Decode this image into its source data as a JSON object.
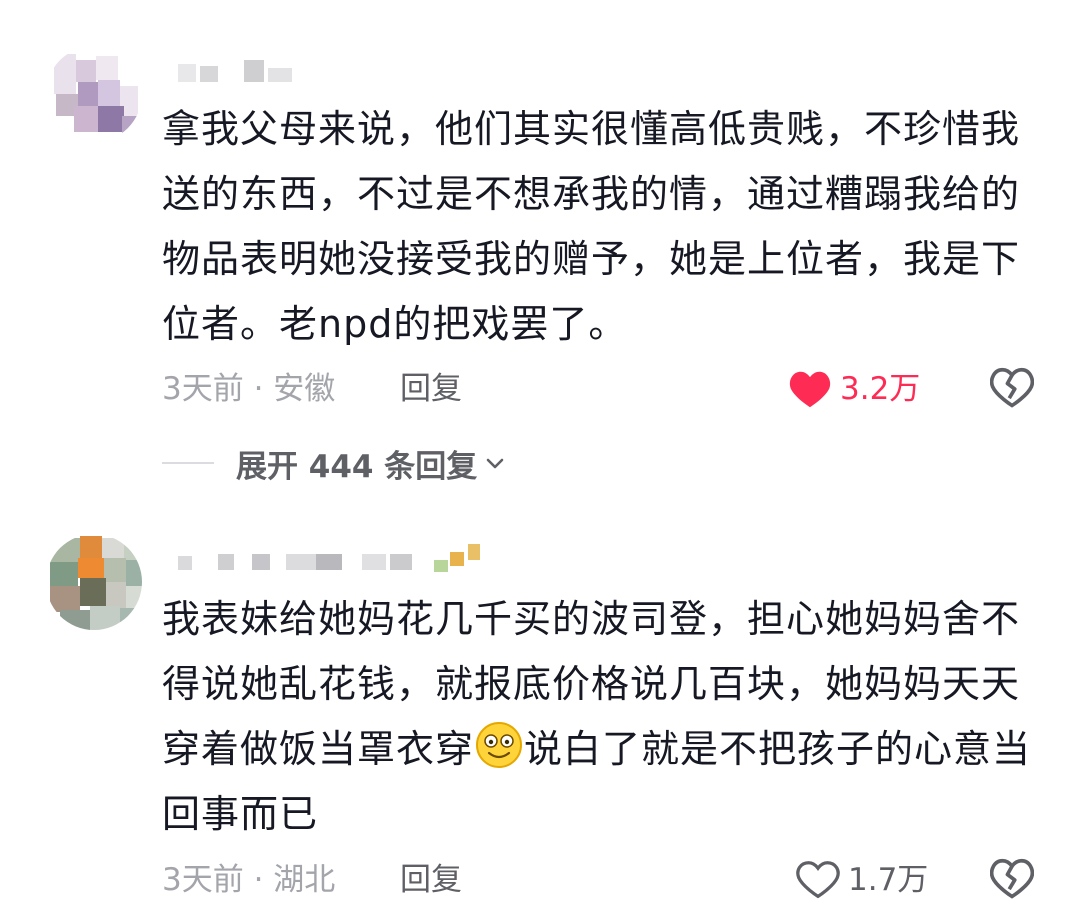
{
  "comments": [
    {
      "body": "拿我父母来说，他们其实很懂高低贵贱，不珍惜我送的东西，不过是不想承我的情，通过糟蹋我给的物品表明她没接受我的赠予，她是上位者，我是下位者。老npd的把戏罢了。",
      "meta": "3天前 · 安徽",
      "reply_label": "回复",
      "like_count": "3.2万",
      "liked": true,
      "like_icon": "heart-filled-icon",
      "dislike_icon": "broken-heart-icon",
      "expand_label": "展开 444 条回复"
    },
    {
      "body_part1": "我表妹给她妈花几千买的波司登，担心她妈妈舍不得说她乱花钱，就报底价格说几百块，她妈妈天天穿着做饭当罩衣穿",
      "emoji": "smile-emoji-icon",
      "body_part2": "说白了就是不把孩子的心意当回事而已",
      "meta": "3天前 · 湖北",
      "reply_label": "回复",
      "like_count": "1.7万",
      "liked": false,
      "like_icon": "heart-outline-icon",
      "dislike_icon": "broken-heart-icon"
    }
  ],
  "colors": {
    "like_red": "#fe2c55",
    "meta_gray": "#a3a5ab",
    "text": "#161823"
  }
}
